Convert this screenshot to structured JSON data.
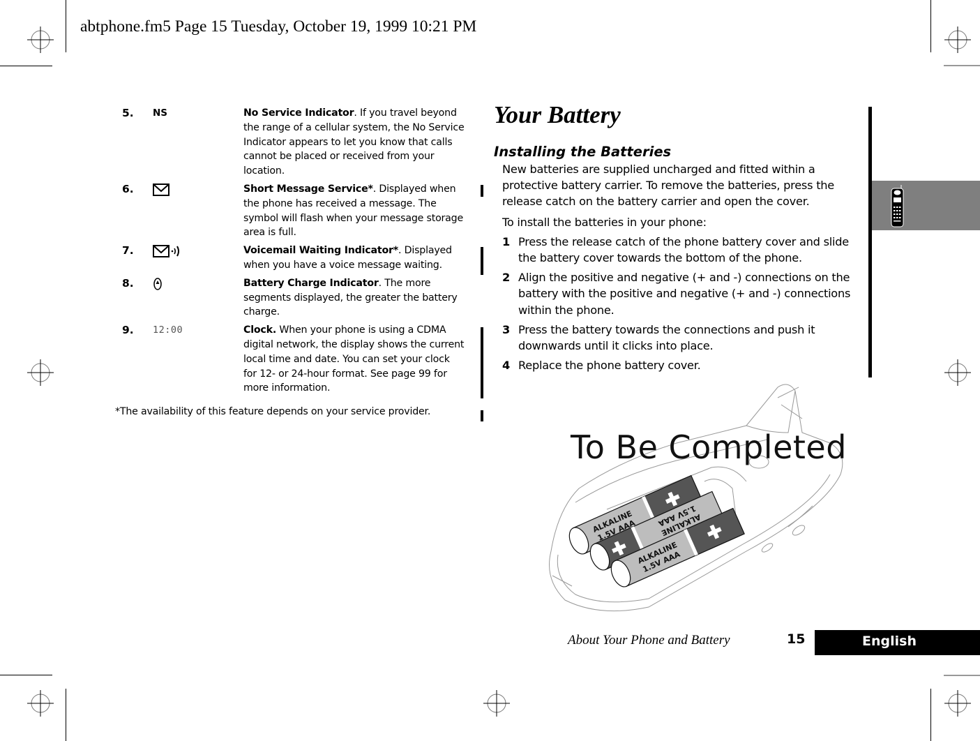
{
  "print_stamp": "abtphone.fm5  Page 15  Tuesday, October 19, 1999  10:21 PM",
  "indicators": [
    {
      "number": "5.",
      "symbol_text": "NS",
      "symbol_icon": "no-service-text",
      "title": "No Service Indicator",
      "title_suffix": ".",
      "body": " If you travel beyond the range of a cellular system, the No Service Indicator appears to let you know that calls cannot be placed or received from your location."
    },
    {
      "number": "6.",
      "symbol_text": "",
      "symbol_icon": "envelope-icon",
      "title": "Short Message Service*",
      "title_suffix": ".",
      "body": " Displayed when the phone has received a message. The symbol will flash when your message storage area is full."
    },
    {
      "number": "7.",
      "symbol_text": "",
      "symbol_icon": "voicemail-envelope-icon",
      "title": "Voicemail Waiting Indicator*",
      "title_suffix": ".",
      "body": " Displayed when you have a voice message waiting."
    },
    {
      "number": "8.",
      "symbol_text": "",
      "symbol_icon": "battery-charge-icon",
      "title": "Battery Charge Indicator",
      "title_suffix": ".",
      "body": " The more segments displayed, the greater the battery charge."
    },
    {
      "number": "9.",
      "symbol_text": "12:00",
      "symbol_icon": "clock-display",
      "title": "Clock.",
      "title_suffix": "",
      "body": " When your phone is using a CDMA digital network, the display shows the current local time and date. You can set your clock for 12- or 24-hour format. See page 99 for more information."
    }
  ],
  "footnote": "*The availability of this feature depends on your service provider.",
  "section": {
    "title": "Your Battery",
    "subtitle": "Installing the Batteries",
    "intro": "New batteries are supplied uncharged and fitted within a protective battery carrier. To remove the batteries, press the release catch on the battery carrier and open the cover.",
    "lead": "To install the batteries in your phone:",
    "steps": [
      {
        "n": "1",
        "text": "Press the release catch of the phone battery cover and slide the battery cover towards the bottom of the phone."
      },
      {
        "n": "2",
        "text": "Align the positive and negative (+ and -) connections on the battery with the positive and negative (+ and -) connections within the phone."
      },
      {
        "n": "3",
        "text": "Press the battery towards the connections and push it downwards until it clicks into place."
      },
      {
        "n": "4",
        "text": "Replace the phone battery cover."
      }
    ]
  },
  "illustration": {
    "overlay_text": "To Be Completed",
    "battery_label_1": "ALKALINE",
    "battery_label_2": "1.5V AAA",
    "battery_count": 3
  },
  "footer": {
    "chapter_title": "About Your Phone and Battery",
    "page_number": "15",
    "language_tab": "English"
  },
  "colors": {
    "thumb_tab": "#7f7f7f",
    "language_tab_bg": "#000000",
    "language_tab_text": "#ffffff",
    "battery_dark": "#555555",
    "battery_light": "#bdbdbd"
  }
}
